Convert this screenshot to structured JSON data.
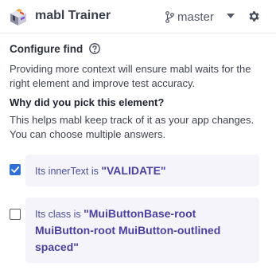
{
  "header": {
    "logo_icon": "mabl-logo-icon",
    "title": "mabl Trainer",
    "branch_icon": "git-branch-icon",
    "branch_name": "master",
    "dropdown_icon": "chevron-down-icon",
    "settings_icon": "gear-icon"
  },
  "section": {
    "title": "Configure find",
    "help_icon": "help-circle-icon",
    "description": "Providing more context will ensure mabl waits for the right element and improve test accuracy.",
    "question": "Why did you pick this element?",
    "hint": "This helps mabl keep track of it as your app changes. You can choose multiple answers."
  },
  "options": [
    {
      "prefix": "Its innerText is ",
      "value": "\"VALIDATE\"",
      "checked": true
    },
    {
      "prefix": "Its class is ",
      "value": "\"MuiButtonBase-root MuiButton-root MuiButton-outlined spaced\"",
      "checked": false
    }
  ],
  "colors": {
    "accent": "#2f6fd6",
    "card_background": "#f4f4fa",
    "value_text": "#4a3fa0"
  }
}
